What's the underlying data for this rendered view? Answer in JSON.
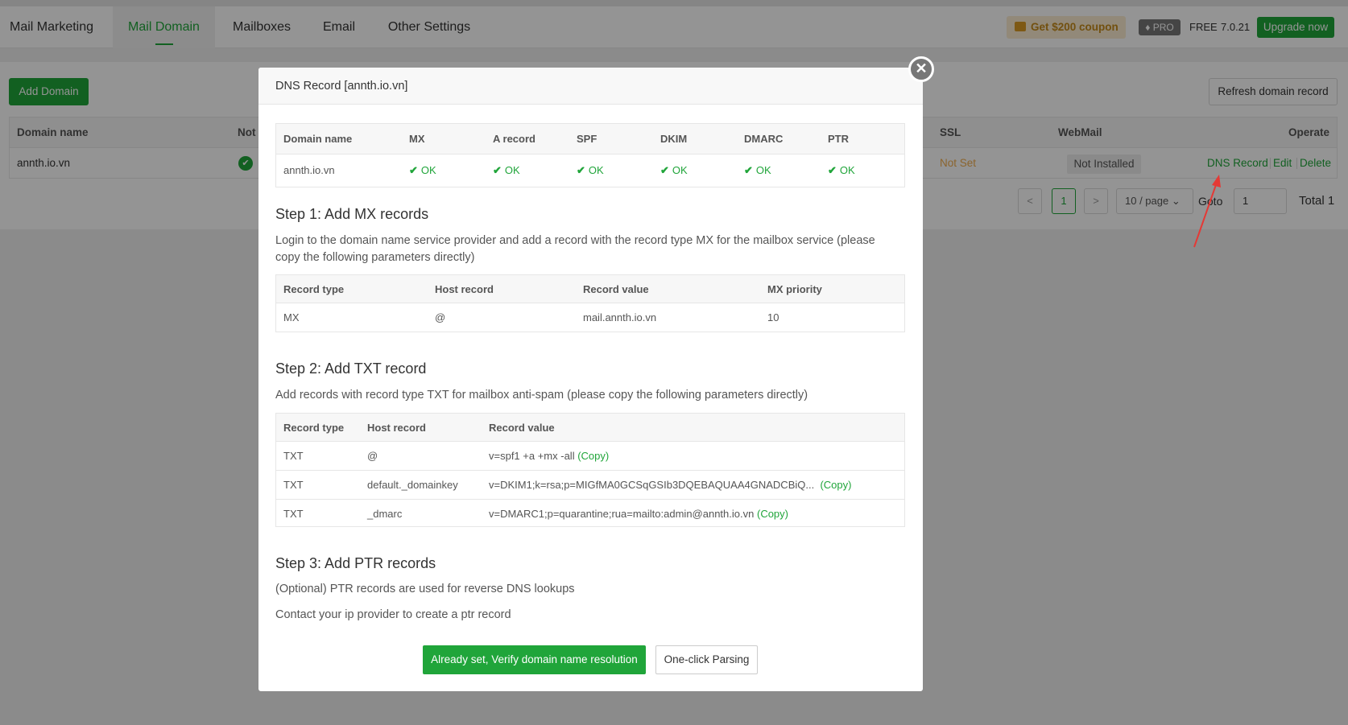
{
  "nav": {
    "tabs": [
      "Mail Marketing",
      "Mail Domain",
      "Mailboxes",
      "Email",
      "Other Settings"
    ],
    "coupon": "Get $200 coupon",
    "pro": "PRO",
    "free": "FREE",
    "version": "7.0.21",
    "upgrade": "Upgrade now"
  },
  "page": {
    "add_domain": "Add Domain",
    "refresh": "Refresh domain record",
    "columns": {
      "domain": "Domain name",
      "not": "Not",
      "ssl": "SSL",
      "webmail": "WebMail",
      "operate": "Operate"
    },
    "row": {
      "domain": "annth.io.vn",
      "ssl": "Not Set",
      "webmail": "Not Installed"
    },
    "ops": {
      "dns": "DNS Record",
      "edit": "Edit",
      "delete": "Delete"
    },
    "pager": {
      "prev": "<",
      "current": "1",
      "next": ">",
      "page_size": "10 / page",
      "goto": "Goto",
      "goto_value": "1",
      "total": "Total 1"
    }
  },
  "modal": {
    "title": "DNS Record [annth.io.vn]",
    "status_table": {
      "headers": [
        "Domain name",
        "MX",
        "A record",
        "SPF",
        "DKIM",
        "DMARC",
        "PTR"
      ],
      "domain": "annth.io.vn",
      "statuses": [
        "OK",
        "OK",
        "OK",
        "OK",
        "OK",
        "OK"
      ]
    },
    "step1": {
      "title": "Step 1: Add MX records",
      "desc": "Login to the domain name service provider and add a record with the record type MX for the mailbox service (please copy the following parameters directly)",
      "headers": [
        "Record type",
        "Host record",
        "Record value",
        "MX priority"
      ],
      "row": [
        "MX",
        "@",
        "mail.annth.io.vn",
        "10"
      ]
    },
    "step2": {
      "title": "Step 2: Add TXT record",
      "desc": "Add records with record type TXT for mailbox anti-spam (please copy the following parameters directly)",
      "headers": [
        "Record type",
        "Host record",
        "Record value"
      ],
      "rows": [
        {
          "type": "TXT",
          "host": "@",
          "value": "v=spf1 +a +mx -all",
          "copy": "(Copy)"
        },
        {
          "type": "TXT",
          "host": "default._domainkey",
          "value": "v=DKIM1;k=rsa;p=MIGfMA0GCSqGSIb3DQEBAQUAA4GNADCBiQ...",
          "copy": "(Copy)"
        },
        {
          "type": "TXT",
          "host": "_dmarc",
          "value": "v=DMARC1;p=quarantine;rua=mailto:admin@annth.io.vn",
          "copy": "(Copy)"
        }
      ]
    },
    "step3": {
      "title": "Step 3: Add PTR records",
      "desc1": "(Optional) PTR records are used for reverse DNS lookups",
      "desc2": "Contact your ip provider to create a ptr record"
    },
    "verify_button": "Already set, Verify domain name resolution",
    "parse_button": "One-click Parsing"
  },
  "colors": {
    "accent": "#20a53a",
    "warning": "#f0ad4e",
    "annotation_arrow": "#e53935"
  },
  "icons": [
    "gift-icon",
    "diamond-icon",
    "check-circle-icon",
    "check-icon",
    "close-icon",
    "chevron-left-icon",
    "chevron-right-icon",
    "chevron-down-icon"
  ]
}
